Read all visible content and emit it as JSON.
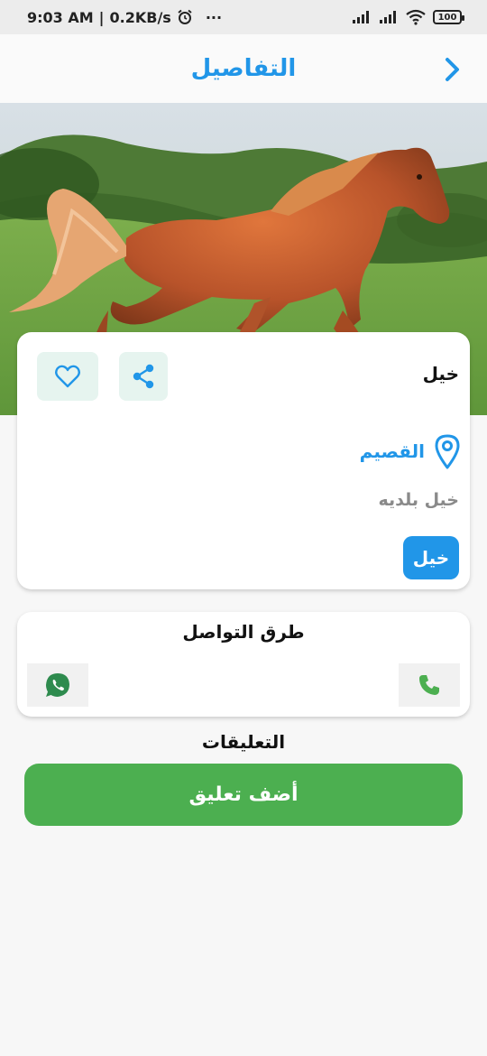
{
  "status_bar": {
    "time": "9:03 AM",
    "speed": "0.2KB/s",
    "more": "···",
    "battery": "100"
  },
  "header": {
    "title": "التفاصيل"
  },
  "details": {
    "name": "خيل",
    "location": "القصيم",
    "description": "خيل بلديه",
    "category": "خيل"
  },
  "contact": {
    "title": "طرق التواصل"
  },
  "comments": {
    "title": "التعليقات",
    "add_button": "أضف تعليق"
  },
  "colors": {
    "accent": "#2196e8",
    "green": "#4caf50",
    "icon_bg": "#e6f4ef"
  },
  "icons": {
    "back": "chevron-right-icon",
    "favorite": "heart-icon",
    "share": "share-icon",
    "location": "location-pin-icon",
    "whatsapp": "whatsapp-icon",
    "phone": "phone-icon"
  }
}
